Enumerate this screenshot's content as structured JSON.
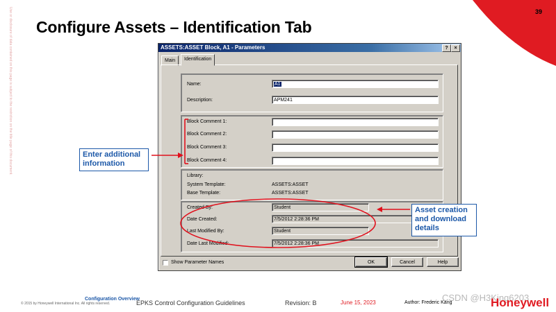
{
  "slide": {
    "page_number": "39",
    "title": "Configure Assets – Identification Tab"
  },
  "side_note": "Use or disclosure of data contained on this page is subject to the restriction on the title page of this document.",
  "dialog": {
    "title": "ASSETS:ASSET Block, A1 - Parameters",
    "help_btn": "?",
    "close_btn": "×",
    "tabs": [
      {
        "label": "Main",
        "active": false
      },
      {
        "label": "Identification",
        "active": true
      }
    ],
    "name_label": "Name:",
    "name_value": "A1",
    "description_label": "Description:",
    "description_value": "APM241",
    "block_comments": [
      {
        "label": "Block Comment 1:",
        "value": ""
      },
      {
        "label": "Block Comment 2:",
        "value": ""
      },
      {
        "label": "Block Comment 3:",
        "value": ""
      },
      {
        "label": "Block Comment 4:",
        "value": ""
      }
    ],
    "library_label": "Library:",
    "system_template_label": "System Template:",
    "system_template_value": "ASSETS:ASSET",
    "base_template_label": "Base Template:",
    "base_template_value": "ASSETS:ASSET",
    "created_by_label": "Created By:",
    "created_by_value": "Student",
    "date_created_label": "Date Created:",
    "date_created_value": "7/5/2012 2:28:36 PM",
    "last_modified_by_label": "Last Modified By:",
    "last_modified_by_value": "Student",
    "date_last_modified_label": "Date Last Modified:",
    "date_last_modified_value": "7/5/2012 2:28:36 PM",
    "show_param_names_label": "Show Parameter Names",
    "ok_label": "OK",
    "cancel_label": "Cancel",
    "help_label": "Help"
  },
  "callouts": {
    "enter_info": "Enter additional information",
    "asset_creation": "Asset creation and download details"
  },
  "footer": {
    "copyright": "© 2015 by Honeywell International Inc. All rights reserved.",
    "section": "Configuration Overview",
    "course": "EPKS Control Configuration Guidelines",
    "revision": "Revision: B",
    "date": "June 15, 2023",
    "author": "Author: Frederic Kang",
    "watermark": "CSDN @H3King6203",
    "logo": "Honeywell"
  },
  "colors": {
    "callout_blue": "#1c58a8",
    "annotation_red": "#e0101c",
    "brand_red": "#e01b22"
  }
}
